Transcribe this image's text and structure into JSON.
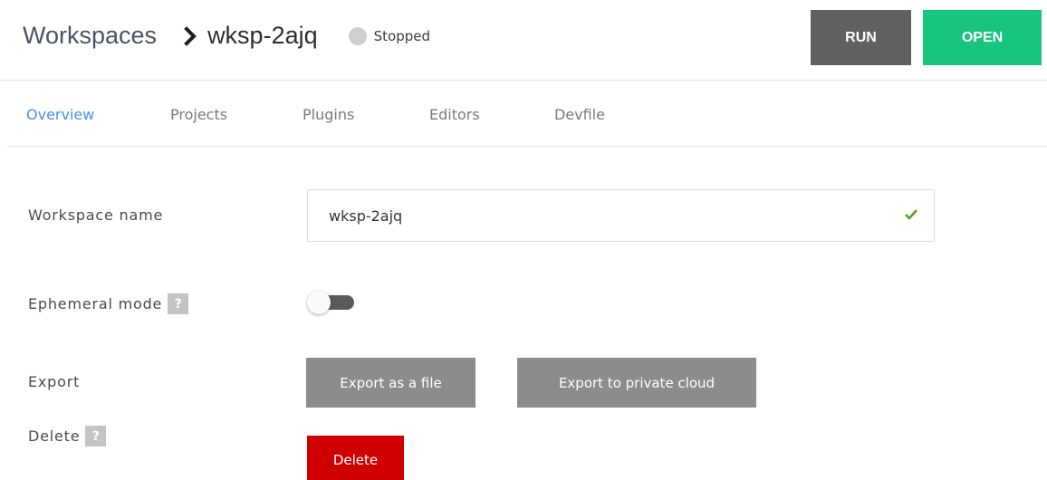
{
  "header": {
    "breadcrumb_root": "Workspaces",
    "breadcrumb_current": "wksp-2ajq",
    "status": {
      "label": "Stopped",
      "color": "#cfcfcf"
    },
    "run_label": "RUN",
    "open_label": "OPEN"
  },
  "tabs": [
    {
      "label": "Overview",
      "active": true
    },
    {
      "label": "Projects",
      "active": false
    },
    {
      "label": "Plugins",
      "active": false
    },
    {
      "label": "Editors",
      "active": false
    },
    {
      "label": "Devfile",
      "active": false
    }
  ],
  "form": {
    "workspace_name": {
      "label": "Workspace name",
      "value": "wksp-2ajq",
      "valid": true,
      "valid_icon": "check-icon"
    },
    "ephemeral_mode": {
      "label": "Ephemeral mode",
      "help": "?",
      "enabled": false
    },
    "export": {
      "label": "Export",
      "file_button": "Export as a file",
      "cloud_button": "Export to private cloud"
    },
    "delete": {
      "label": "Delete",
      "help": "?",
      "button": "Delete"
    }
  },
  "colors": {
    "accent": "#4a90e2",
    "run": "#616161",
    "open": "#19c47f",
    "danger": "#d10000",
    "valid": "#5aa02c"
  }
}
